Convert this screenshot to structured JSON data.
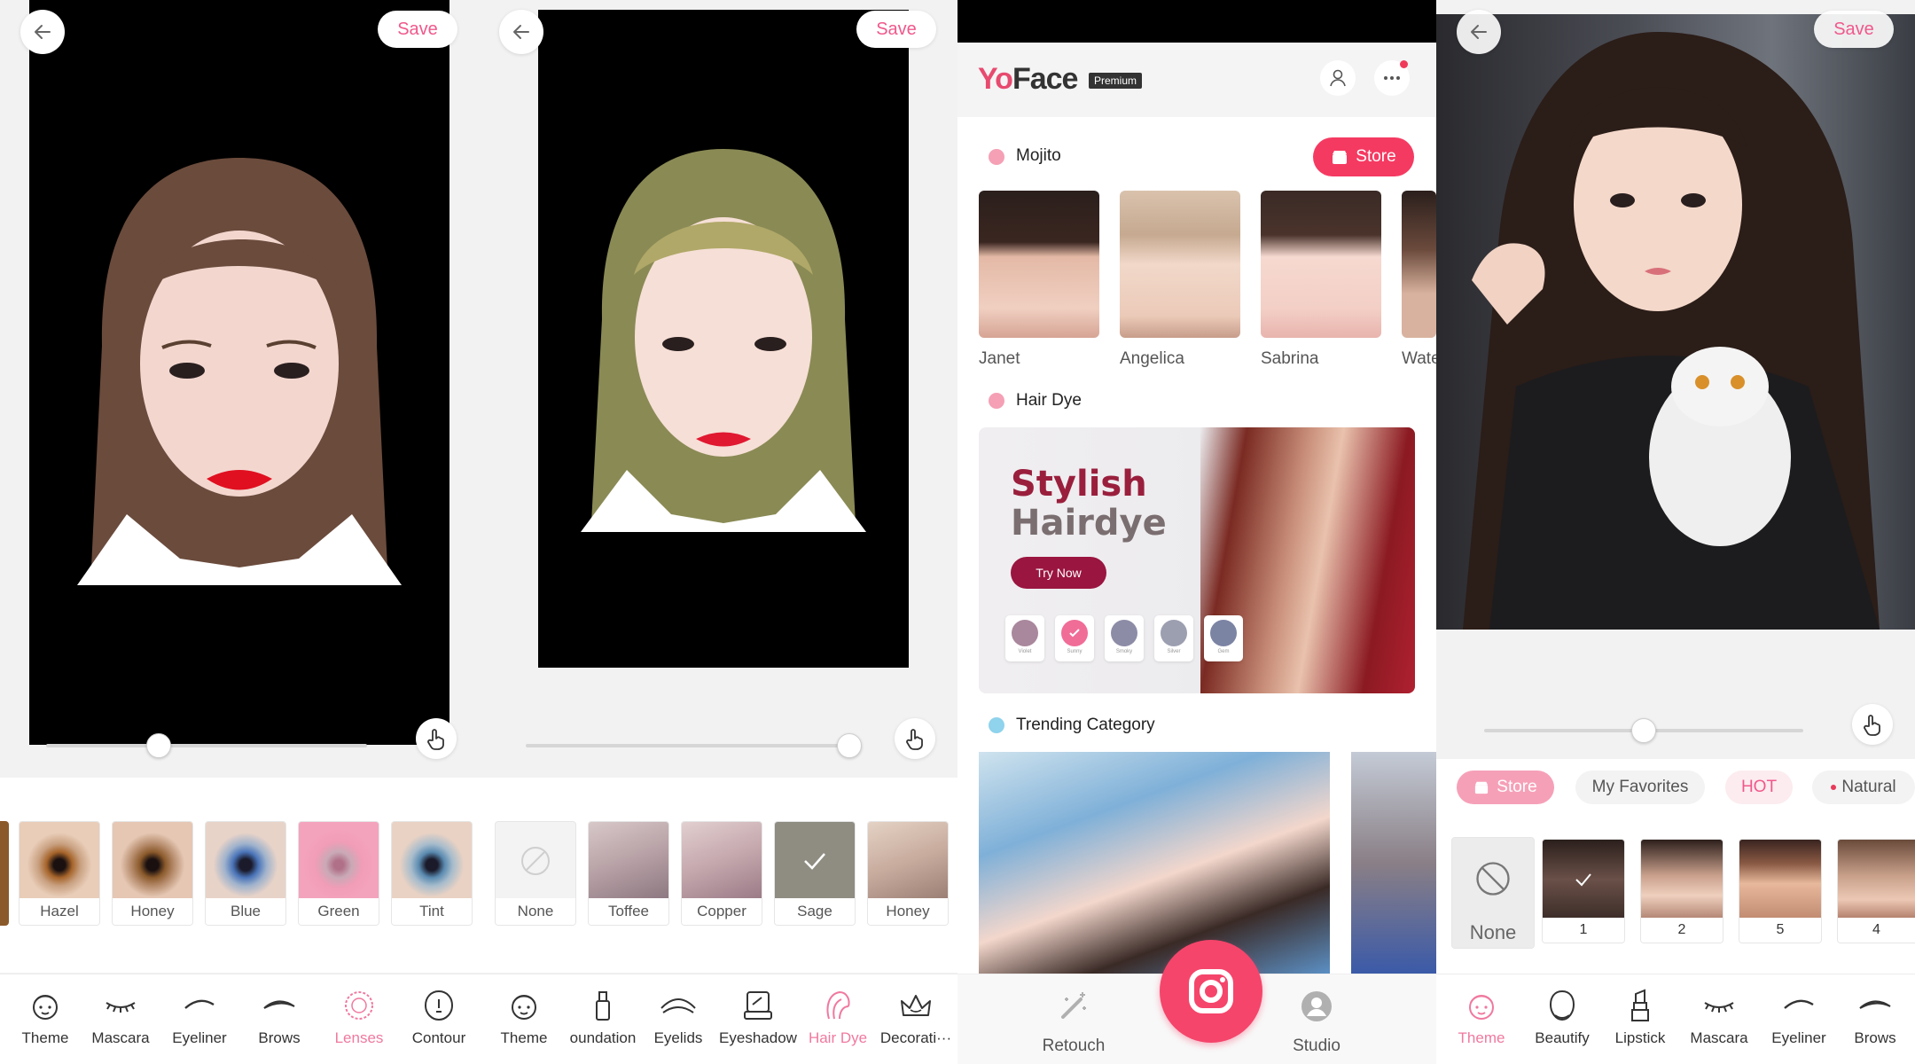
{
  "common": {
    "save_label": "Save"
  },
  "panel1": {
    "slider_level": 0.35,
    "lenses": [
      {
        "label": "Hazel",
        "color": "#a6642a"
      },
      {
        "label": "Honey",
        "color": "#8b5a2b"
      },
      {
        "label": "Blue",
        "color": "#4a74b8"
      },
      {
        "label": "Green",
        "color": "#c9a9b6"
      },
      {
        "label": "Tint",
        "color": "#5a8ab0"
      }
    ],
    "tools": [
      {
        "label": "Theme",
        "icon": "theme-face-icon"
      },
      {
        "label": "Mascara",
        "icon": "mascara-lash-icon"
      },
      {
        "label": "Eyeliner",
        "icon": "eyeliner-icon"
      },
      {
        "label": "Brows",
        "icon": "brows-icon"
      },
      {
        "label": "Lenses",
        "icon": "lenses-icon"
      },
      {
        "label": "Contour",
        "icon": "contour-icon"
      }
    ]
  },
  "panel2": {
    "slider_level": 0.97,
    "hair_colors": [
      {
        "label": "None"
      },
      {
        "label": "Toffee"
      },
      {
        "label": "Copper"
      },
      {
        "label": "Sage"
      },
      {
        "label": "Honey"
      }
    ],
    "tools": [
      {
        "label": "Theme",
        "icon": "theme-face-icon"
      },
      {
        "label": "oundation",
        "icon": "foundation-bottle-icon"
      },
      {
        "label": "Eyelids",
        "icon": "eyelids-icon"
      },
      {
        "label": "Eyeshadow",
        "icon": "eyeshadow-palette-icon"
      },
      {
        "label": "Hair Dye",
        "icon": "hair-dye-icon"
      },
      {
        "label": "Decorati···",
        "icon": "decoration-crown-icon"
      }
    ]
  },
  "panel3": {
    "logo_text_a": "Yo",
    "logo_text_b": "Face",
    "premium_badge": "Premium",
    "sections": {
      "mojito": "Mojito",
      "hair_dye": "Hair Dye",
      "trending": "Trending Category"
    },
    "store_label": "Store",
    "models": [
      "Janet",
      "Angelica",
      "Sabrina",
      "Wate"
    ],
    "banner": {
      "line1": "Stylish",
      "line2": "Hairdye",
      "cta": "Try Now",
      "chips": [
        "Violet",
        "Sunny",
        "Smoky",
        "Silver",
        "Gem"
      ]
    },
    "nav": {
      "retouch": "Retouch",
      "studio": "Studio"
    }
  },
  "panel4": {
    "slider_level": 0.5,
    "filters": {
      "store": "Store",
      "favorites": "My Favorites",
      "hot": "HOT",
      "natural": "Natural"
    },
    "themes": [
      "None",
      "1",
      "2",
      "5",
      "4"
    ],
    "tools": [
      {
        "label": "Theme",
        "icon": "theme-face-icon"
      },
      {
        "label": "Beautify",
        "icon": "beautify-face-icon"
      },
      {
        "label": "Lipstick",
        "icon": "lipstick-icon"
      },
      {
        "label": "Mascara",
        "icon": "mascara-lash-icon"
      },
      {
        "label": "Eyeliner",
        "icon": "eyeliner-icon"
      },
      {
        "label": "Brows",
        "icon": "brows-icon"
      }
    ]
  },
  "colors": {
    "accent_pink": "#f0588c",
    "store_red": "#f53a62",
    "active_tool": "#f0799f"
  }
}
